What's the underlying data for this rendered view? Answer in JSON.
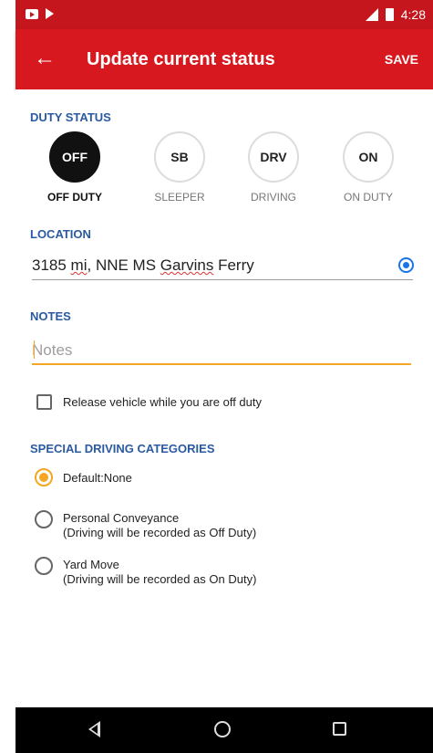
{
  "status_bar": {
    "time": "4:28",
    "icons": [
      "youtube-icon",
      "play-store-icon",
      "signal-icon",
      "battery-icon"
    ]
  },
  "app_bar": {
    "title": "Update current status",
    "save_label": "SAVE",
    "back_icon": "arrow-left-icon",
    "background_color": "#d7191f"
  },
  "duty_status": {
    "label": "DUTY STATUS",
    "options": [
      {
        "code": "OFF",
        "caption": "OFF DUTY",
        "selected": true
      },
      {
        "code": "SB",
        "caption": "SLEEPER",
        "selected": false
      },
      {
        "code": "DRV",
        "caption": "DRIVING",
        "selected": false
      },
      {
        "code": "ON",
        "caption": "ON DUTY",
        "selected": false
      }
    ]
  },
  "location": {
    "label": "LOCATION",
    "value_prefix": "3185 ",
    "value_unit": "mi",
    "value_middle": ", NNE MS ",
    "value_place": "Garvins",
    "value_suffix": " Ferry",
    "icon": "my-location-icon"
  },
  "notes": {
    "label": "NOTES",
    "placeholder": "Notes",
    "value": ""
  },
  "release_vehicle": {
    "label": "Release vehicle while you are off duty",
    "checked": false
  },
  "special_driving": {
    "label": "SPECIAL DRIVING CATEGORIES",
    "options": [
      {
        "label": "Default:None",
        "sublabel": "",
        "selected": true
      },
      {
        "label": "Personal Conveyance",
        "sublabel": "(Driving will be recorded as Off Duty)",
        "selected": false
      },
      {
        "label": "Yard Move",
        "sublabel": "(Driving will be recorded as On Duty)",
        "selected": false
      }
    ]
  },
  "nav_bar": {
    "icons": [
      "nav-back-icon",
      "nav-home-icon",
      "nav-recents-icon"
    ]
  },
  "colors": {
    "accent": "#f5a623",
    "section_label": "#2a5aa0",
    "location_icon": "#1a73e8"
  }
}
